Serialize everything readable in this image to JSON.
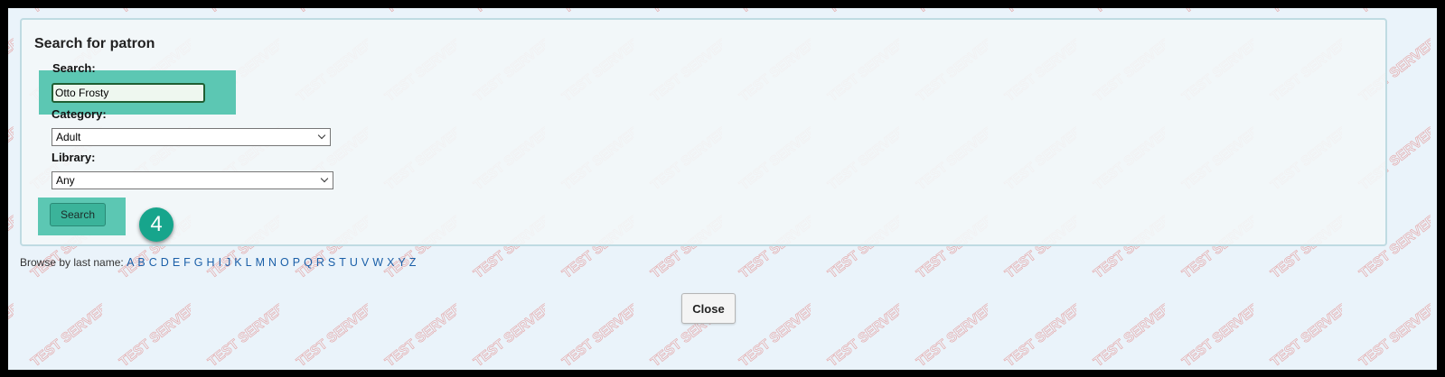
{
  "panel": {
    "title": "Search for patron",
    "search_label": "Search:",
    "search_value": "Otto Frosty",
    "category_label": "Category:",
    "category_selected": "Adult",
    "library_label": "Library:",
    "library_selected": "Any",
    "search_button": "Search",
    "step_badge": "4"
  },
  "browse": {
    "label": "Browse by last name:",
    "letters": [
      "A",
      "B",
      "C",
      "D",
      "E",
      "F",
      "G",
      "H",
      "I",
      "J",
      "K",
      "L",
      "M",
      "N",
      "O",
      "P",
      "Q",
      "R",
      "S",
      "T",
      "U",
      "V",
      "W",
      "X",
      "Y",
      "Z"
    ]
  },
  "footer": {
    "close_button": "Close"
  },
  "watermark": {
    "text": "TEST SERVER",
    "color": "#e4a0a0"
  },
  "colors": {
    "highlight": "#5cc7b3",
    "badge": "#17a58c",
    "link": "#1a5fa8"
  }
}
